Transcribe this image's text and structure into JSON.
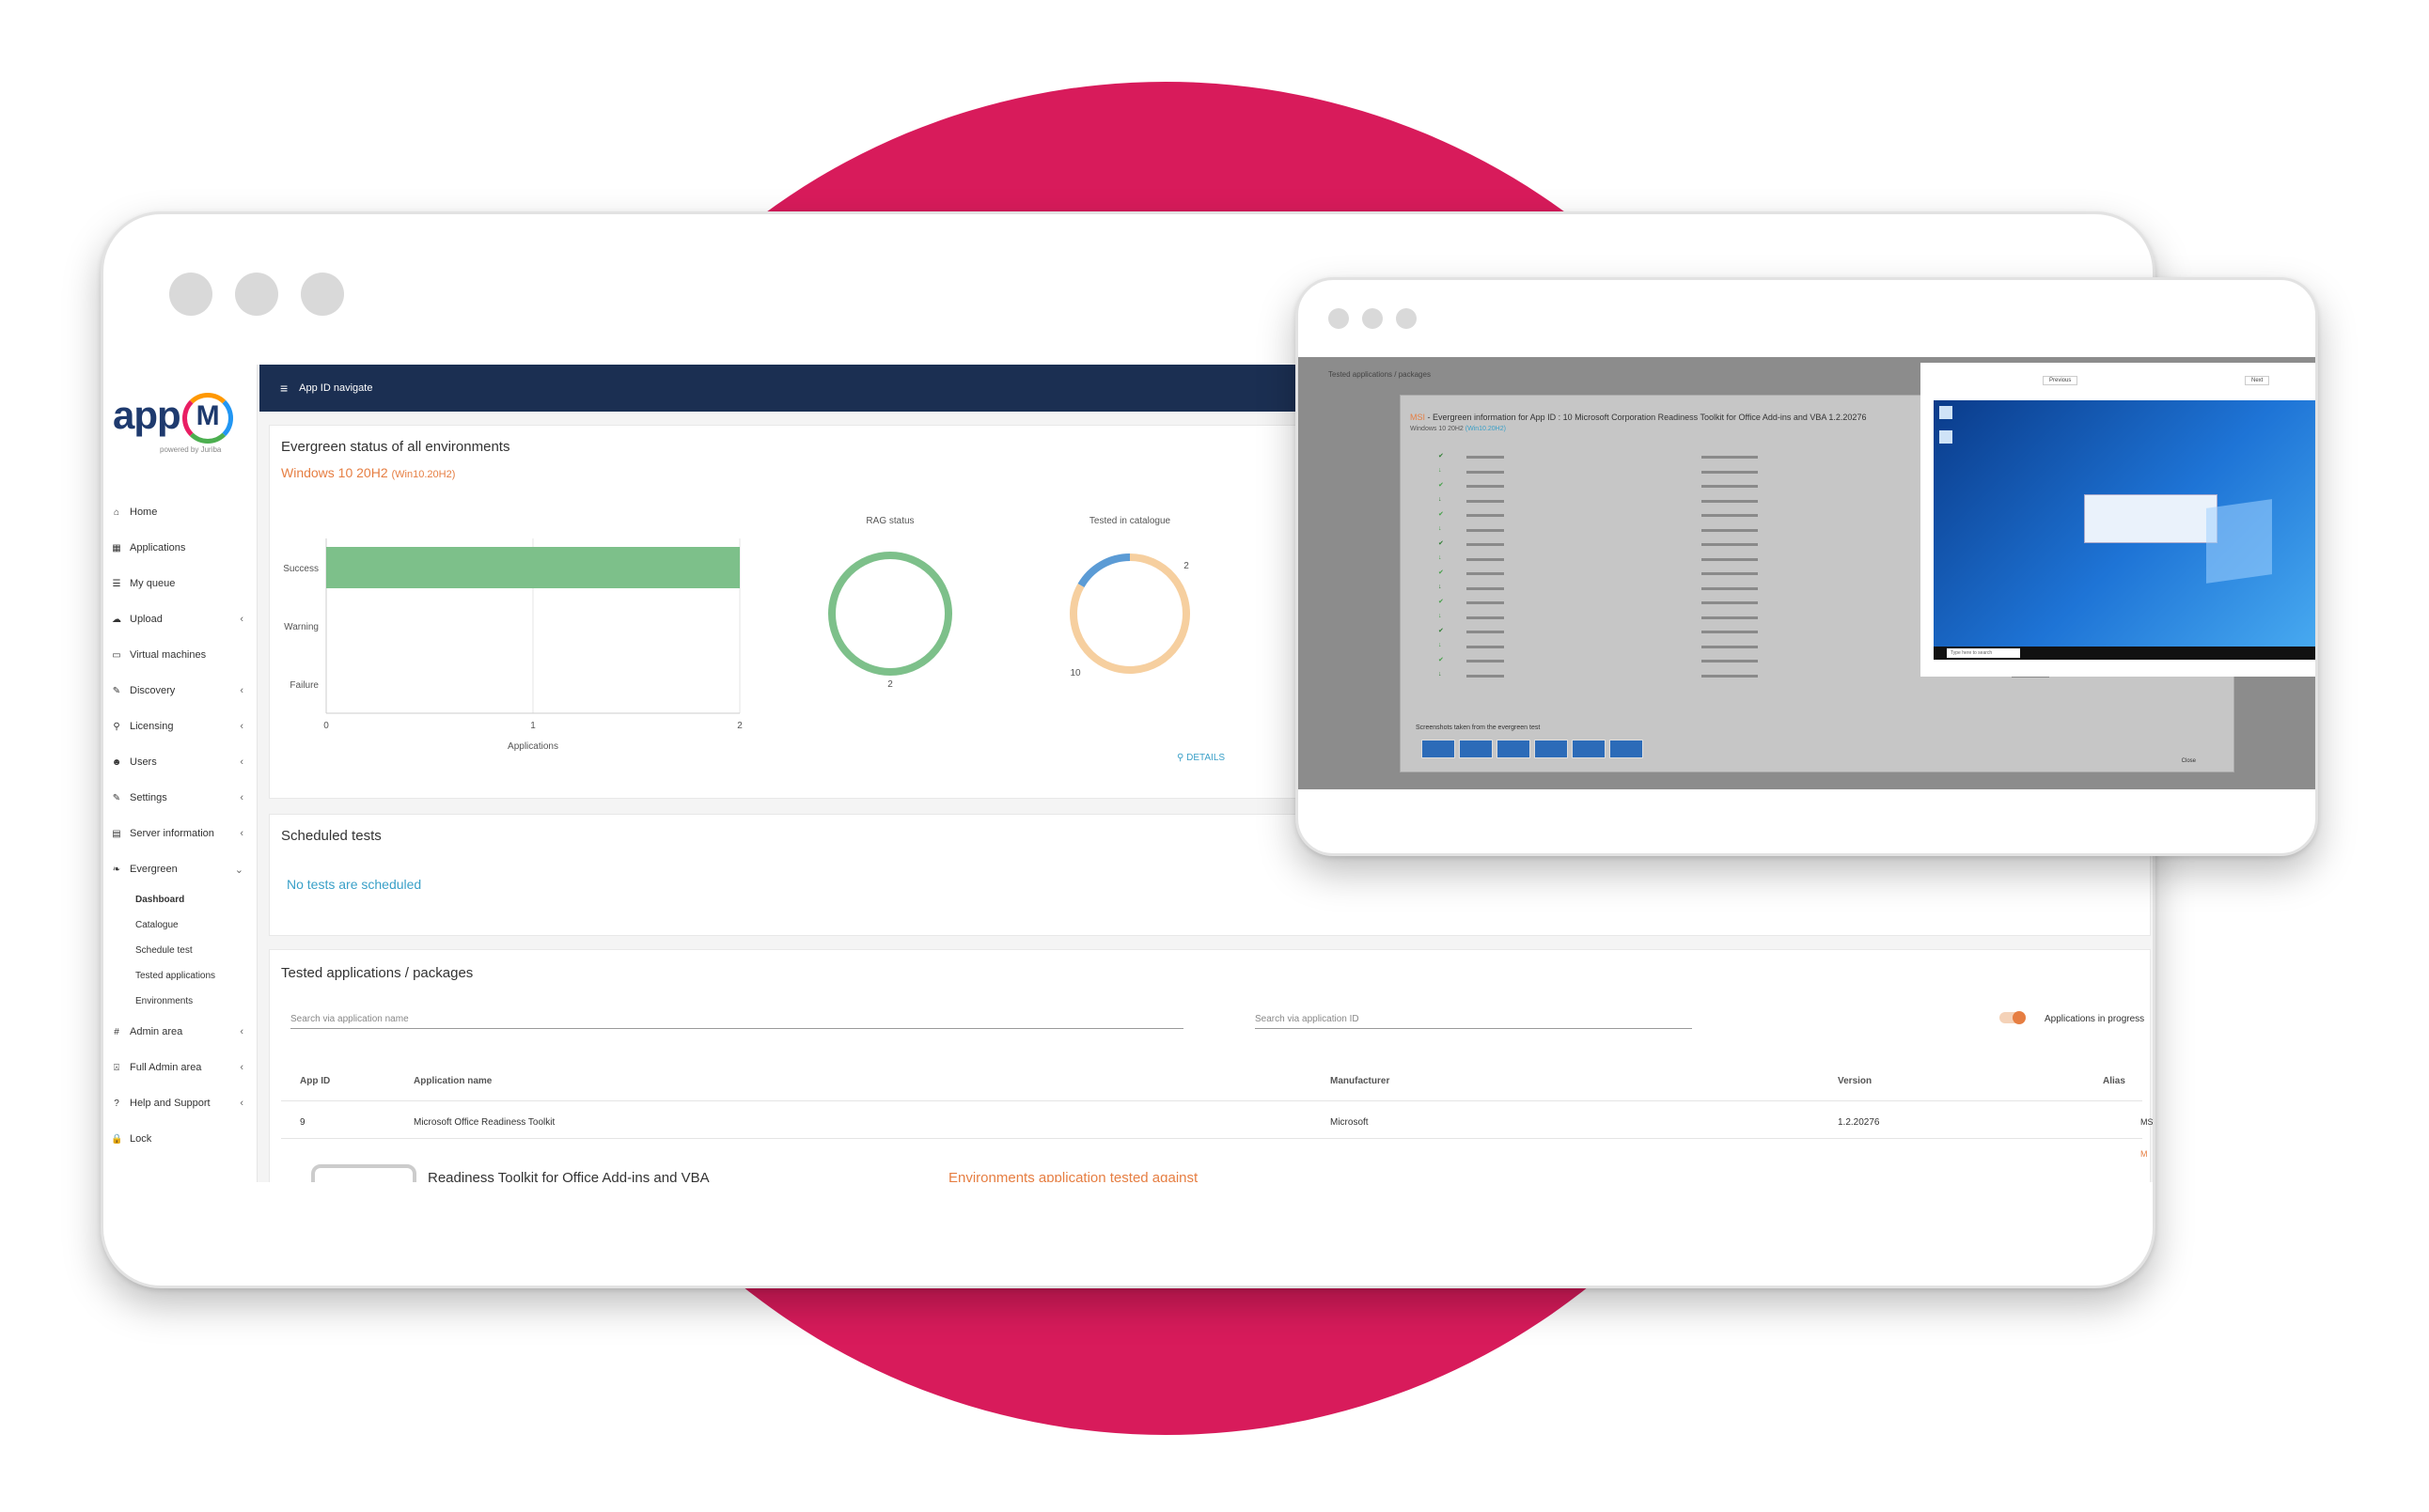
{
  "brand": {
    "logo_text": "app",
    "logo_mark": "M",
    "powered_by": "powered by Juriba"
  },
  "topbar": {
    "title": "App ID navigate"
  },
  "sidebar": {
    "items": [
      {
        "label": "Home",
        "icon": "home-icon",
        "glyph": "⌂",
        "chevron": ""
      },
      {
        "label": "Applications",
        "icon": "grid-icon",
        "glyph": "▦",
        "chevron": ""
      },
      {
        "label": "My queue",
        "icon": "list-icon",
        "glyph": "☰",
        "chevron": ""
      },
      {
        "label": "Upload",
        "icon": "cloud-upload-icon",
        "glyph": "☁",
        "chevron": "‹"
      },
      {
        "label": "Virtual machines",
        "icon": "monitor-icon",
        "glyph": "▭",
        "chevron": ""
      },
      {
        "label": "Discovery",
        "icon": "wand-icon",
        "glyph": "✎",
        "chevron": "‹"
      },
      {
        "label": "Licensing",
        "icon": "key-icon",
        "glyph": "⚲",
        "chevron": "‹"
      },
      {
        "label": "Users",
        "icon": "users-icon",
        "glyph": "☻",
        "chevron": "‹"
      },
      {
        "label": "Settings",
        "icon": "wrench-icon",
        "glyph": "✎",
        "chevron": "‹"
      },
      {
        "label": "Server information",
        "icon": "server-icon",
        "glyph": "▤",
        "chevron": "‹"
      },
      {
        "label": "Evergreen",
        "icon": "leaf-icon",
        "glyph": "❧",
        "chevron": "⌄"
      }
    ],
    "evergreen_sub": [
      "Dashboard",
      "Catalogue",
      "Schedule test",
      "Tested applications",
      "Environments"
    ],
    "items_after": [
      {
        "label": "Admin area",
        "icon": "hash-icon",
        "glyph": "#",
        "chevron": "‹"
      },
      {
        "label": "Full Admin area",
        "icon": "admin-icon",
        "glyph": "⍓",
        "chevron": "‹"
      },
      {
        "label": "Help and Support",
        "icon": "question-icon",
        "glyph": "?",
        "chevron": "‹"
      },
      {
        "label": "Lock",
        "icon": "lock-icon",
        "glyph": "🔒",
        "chevron": ""
      }
    ]
  },
  "evergreen_card": {
    "title": "Evergreen status of all environments",
    "env_name": "Windows 10 20H2",
    "env_code": "(Win10.20H2)",
    "details_label": "DETAILS"
  },
  "chart_data": [
    {
      "type": "bar",
      "orientation": "horizontal",
      "categories": [
        "Success",
        "Warning",
        "Failure"
      ],
      "values": [
        2,
        0,
        0
      ],
      "xlabel": "Applications",
      "xlim": [
        0,
        2
      ],
      "xticks": [
        "0",
        "1",
        "2"
      ],
      "color": "#7dc08a"
    },
    {
      "type": "pie",
      "title": "RAG status",
      "slices": [
        {
          "value": 2,
          "color": "#7dc08a"
        }
      ],
      "labels": [
        "2"
      ]
    },
    {
      "type": "pie",
      "title": "Tested in catalogue",
      "slices": [
        {
          "value": 10,
          "color": "#f6cf9f"
        },
        {
          "value": 2,
          "color": "#5b9bd5"
        }
      ],
      "labels": [
        "10",
        "2"
      ]
    }
  ],
  "scheduled_card": {
    "title": "Scheduled tests",
    "empty_text": "No tests are scheduled"
  },
  "tested_card": {
    "title": "Tested applications / packages",
    "search_name_placeholder": "Search via application name",
    "search_id_placeholder": "Search via application ID",
    "toggle_label": "Applications in progress",
    "columns": [
      "App ID",
      "Application name",
      "Manufacturer",
      "Version",
      "Alias"
    ],
    "rows": [
      {
        "app_id": "9",
        "name": "Microsoft Office Readiness Toolkit",
        "manufacturer": "Microsoft",
        "version": "1.2.20276",
        "alias": "",
        "tag": "MS"
      }
    ],
    "expanded_title": "Readiness Toolkit for Office Add-ins and VBA",
    "expanded_subtitle": "Environments application tested against",
    "edge_tag": "M"
  },
  "popup": {
    "bg_title": "Tested applications / packages",
    "modal_tag": "MSI",
    "modal_title": "- Evergreen information for App ID : 10 Microsoft Corporation Readiness Toolkit for Office Add-ins and VBA 1.2.20276",
    "modal_env": "Windows 10 20H2",
    "modal_env_code": "(Win10.20H2)",
    "screenshots_label": "Screenshots taken from the evergreen test",
    "close_label": "Close",
    "prev_label": "Previous",
    "next_label": "Next",
    "search_placeholder": "Type here to search"
  },
  "colors": {
    "brand_pink": "#d81b5b",
    "navbar": "#1b2f52",
    "accent_orange": "#e67e42",
    "link_blue": "#3aa0c8",
    "success_green": "#7dc08a"
  }
}
